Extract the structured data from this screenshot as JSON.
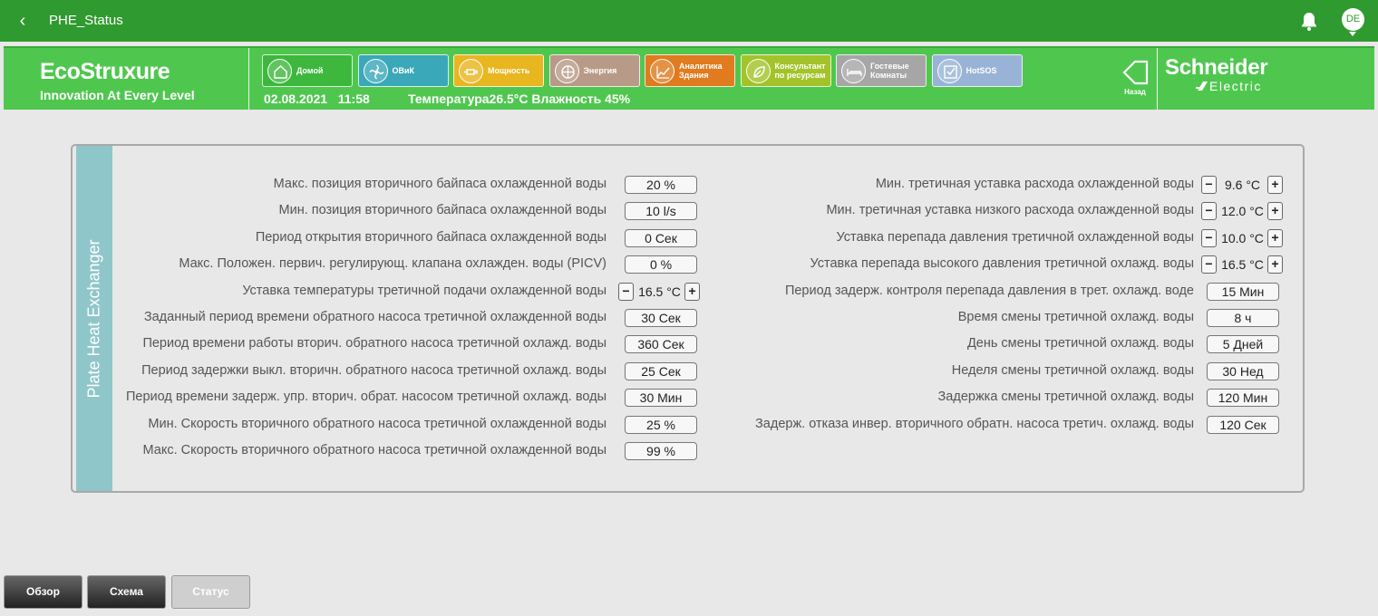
{
  "topbar": {
    "title": "PHE_Status",
    "avatar": "DE"
  },
  "brand": {
    "eco_logo": "EcoStruxure",
    "eco_tagline": "Innovation At Every Level",
    "se_line1": "Schneider",
    "se_line2": "Electric",
    "date": "02.08.2021",
    "time": "11:58",
    "climate": "Температура26.5°C Влажность 45%",
    "back_label": "Назад"
  },
  "nav": [
    {
      "label": "Домой",
      "color": "#3db83d",
      "icon": "home-icon"
    },
    {
      "label": "ОВиК",
      "color": "#3aa8b8",
      "icon": "fan-icon"
    },
    {
      "label": "Мощность",
      "color": "#e8b61f",
      "icon": "plug-icon"
    },
    {
      "label": "Энергия",
      "color": "#b89a88",
      "icon": "energy-icon"
    },
    {
      "label": "Аналитика Здания",
      "color": "#e07b1f",
      "icon": "analytics-icon"
    },
    {
      "label": "Консультант по ресурсам",
      "color": "#a3c32a",
      "icon": "leaf-icon"
    },
    {
      "label": "Гостевые Комнаты",
      "color": "#a6a6a6",
      "icon": "bed-icon"
    },
    {
      "label": "HotSOS",
      "color": "#99b3d6",
      "icon": "checkbox-icon"
    }
  ],
  "panel": {
    "title": "Plate Heat Exchanger",
    "left": [
      {
        "label": "Макс. позиция вторичного байпаса охлажденной воды",
        "value": "20 %"
      },
      {
        "label": "Мин. позиция вторичного байпаса охлажденной воды",
        "value": "10 l/s"
      },
      {
        "label": "Период открытия вторичного байпаса охлажденной воды",
        "value": "0 Сек"
      },
      {
        "label": "Макс. Положен. первич. регулирующ. клапана охлажден. воды (PICV)",
        "value": "0 %"
      },
      {
        "label": "Уставка температуры третичной подачи охлажденной воды",
        "value": "16.5 °C"
      },
      {
        "label": "Заданный период времени обратного насоса третичной охлажденной воды",
        "value": "30 Сек"
      },
      {
        "label": "Период времени работы вторич. обратного насоса третичной охлажд. воды",
        "value": "360 Сек"
      },
      {
        "label": "Период задержки выкл. вторичн. обратного насоса третичной охлажд. воды",
        "value": "25 Сек"
      },
      {
        "label": "Период времени задерж. упр. вторич. обрат. насосом третичной охлажд. воды",
        "value": "30 Мин"
      },
      {
        "label": "Мин. Скорость вторичного обратного насоса третичной охлажденной воды",
        "value": "25 %"
      },
      {
        "label": "Макс. Скорость вторичного обратного насоса третичной охлажденной воды",
        "value": "99 %"
      }
    ],
    "right": [
      {
        "label": "Мин. третичная уставка расхода охлажденной воды",
        "value": "9.6 °C"
      },
      {
        "label": "Мин. третичная уставка низкого расхода охлажденной воды",
        "value": "12.0 °C"
      },
      {
        "label": "Уставка перепада давления третичной охлажденной воды",
        "value": "10.0 °C"
      },
      {
        "label": "Уставка перепада высокого давления третичной охлажд. воды",
        "value": "16.5 °C"
      },
      {
        "label": "Период задерж. контроля перепада давления в трет. охлажд. воде",
        "value": "15 Мин"
      },
      {
        "label": "Время смены третичной охлажд. воды",
        "value": "8 ч"
      },
      {
        "label": "День смены третичной охлажд. воды",
        "value": "5 Дней"
      },
      {
        "label": "Неделя смены третичной охлажд. воды",
        "value": "30 Нед"
      },
      {
        "label": "Задержка смены третичной охлажд. воды",
        "value": "120 Мин"
      },
      {
        "label": "Задерж. отказа инвер. вторичного обратн. насоса третич. охлажд.  воды",
        "value": "120 Сек"
      }
    ],
    "stepper_minus": "−",
    "stepper_plus": "+"
  },
  "bottom": {
    "overview": "Обзор",
    "scheme": "Схема",
    "status": "Статус"
  }
}
